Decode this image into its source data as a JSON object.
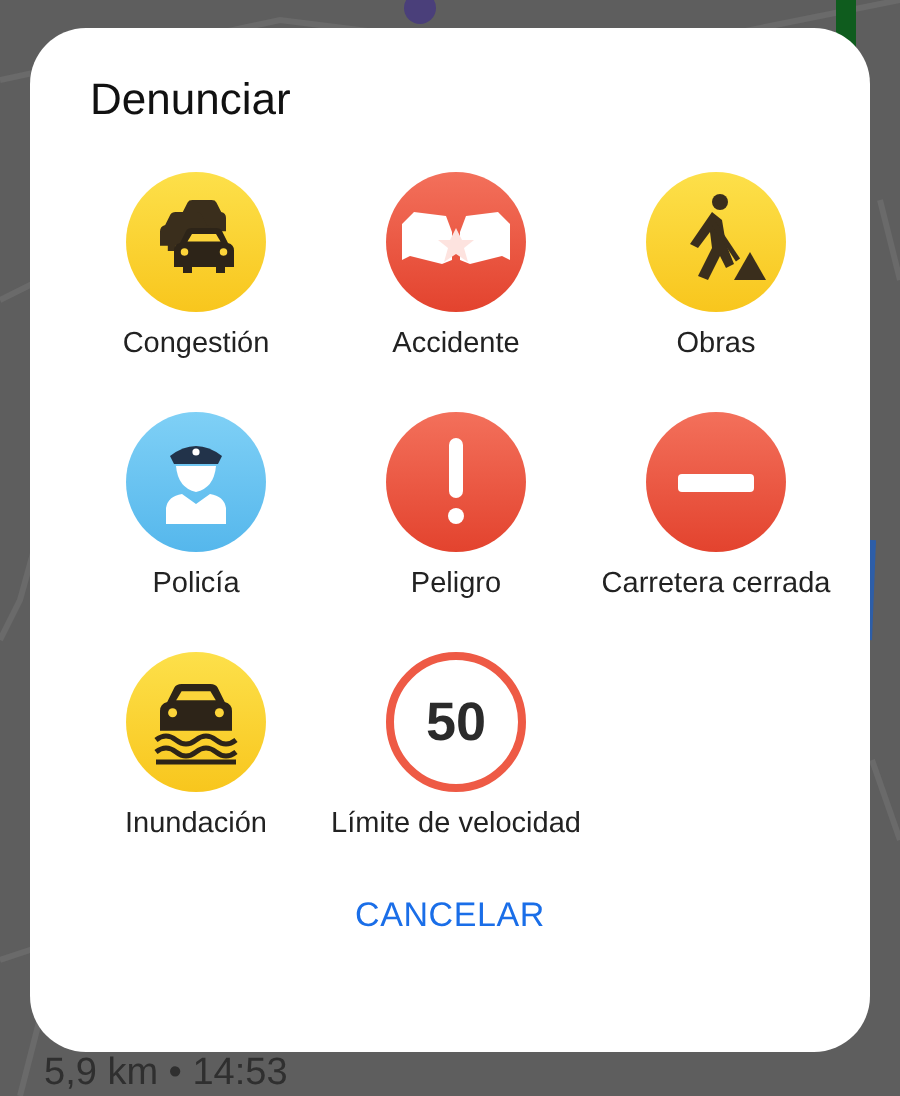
{
  "dialog": {
    "title": "Denunciar",
    "items": [
      {
        "label": "Congestión",
        "kind": "traffic"
      },
      {
        "label": "Accidente",
        "kind": "crash"
      },
      {
        "label": "Obras",
        "kind": "roadwork"
      },
      {
        "label": "Policía",
        "kind": "police"
      },
      {
        "label": "Peligro",
        "kind": "hazard"
      },
      {
        "label": "Carretera cerrada",
        "kind": "closed"
      },
      {
        "label": "Inundación",
        "kind": "flood"
      },
      {
        "label": "Límite de velocidad",
        "kind": "speed",
        "sign": "50"
      }
    ],
    "button": "CANCELAR"
  },
  "trip_summary": "5,9 km • 14:53"
}
